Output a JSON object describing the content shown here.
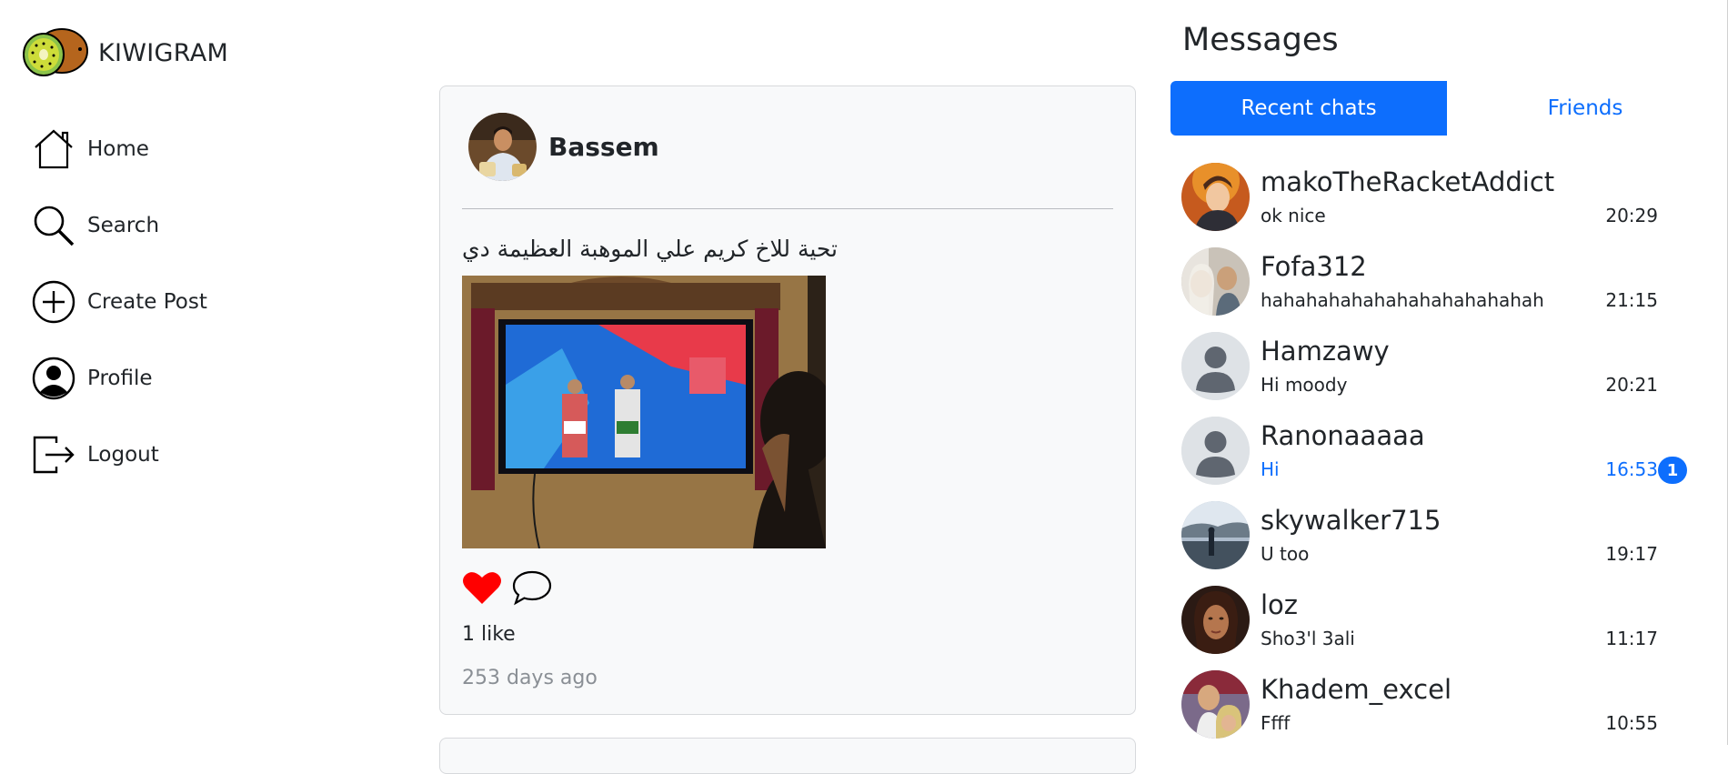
{
  "brand": {
    "name": "KIWIGRAM",
    "logo_icon": "kiwi-logo-icon"
  },
  "nav": {
    "items": [
      {
        "label": "Home",
        "icon": "home-icon"
      },
      {
        "label": "Search",
        "icon": "search-icon"
      },
      {
        "label": "Create Post",
        "icon": "plus-circle-icon"
      },
      {
        "label": "Profile",
        "icon": "user-circle-icon"
      },
      {
        "label": "Logout",
        "icon": "logout-icon"
      }
    ]
  },
  "post": {
    "username": "Bassem",
    "caption": "تحية للاخ كريم علي الموهبة العظيمة دي",
    "likes": "1 like",
    "time": "253 days ago",
    "liked": true,
    "like_color": "#ff0000"
  },
  "messages": {
    "title": "Messages",
    "tabs": [
      {
        "label": "Recent chats",
        "active": true
      },
      {
        "label": "Friends",
        "active": false
      }
    ],
    "chats": [
      {
        "name": "makoTheRacketAddict",
        "last": "ok nice",
        "time": "20:29",
        "unread": 0
      },
      {
        "name": "Fofa312",
        "last": "hahahahahahahahahahahahah",
        "time": "21:15",
        "unread": 0
      },
      {
        "name": "Hamzawy",
        "last": "Hi moody",
        "time": "20:21",
        "unread": 0
      },
      {
        "name": "Ranonaaaaa",
        "last": "Hi",
        "time": "16:53",
        "unread": 1
      },
      {
        "name": "skywalker715",
        "last": "U too",
        "time": "19:17",
        "unread": 0
      },
      {
        "name": "loz",
        "last": "Sho3'l 3ali",
        "time": "11:17",
        "unread": 0
      },
      {
        "name": "Khadem_excel",
        "last": "Ffff",
        "time": "10:55",
        "unread": 0
      }
    ]
  },
  "colors": {
    "accent": "#0d6efd",
    "card_bg": "#f8f9fa"
  }
}
